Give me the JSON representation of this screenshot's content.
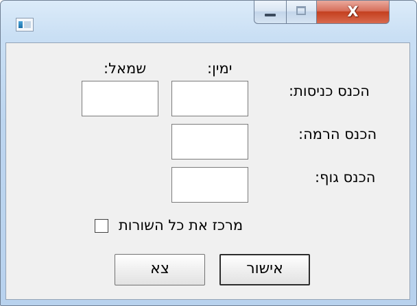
{
  "window": {
    "title": "",
    "controls": {
      "minimize_icon": "minimize-icon",
      "maximize_icon": "maximize-icon",
      "close_glyph": "X"
    }
  },
  "form": {
    "column_right_label": "ימין:",
    "column_left_label": "שמאל:",
    "rows": [
      {
        "label": "הכנס כניסות:",
        "right_value": "",
        "left_value": ""
      },
      {
        "label": "הכנס הרמה:",
        "right_value": ""
      },
      {
        "label": "הכנס גוף:",
        "right_value": ""
      }
    ],
    "center_all_lines_label": "מרכז את כל השורות",
    "center_all_lines_checked": false
  },
  "buttons": {
    "ok_label": "אישור",
    "exit_label": "צא"
  }
}
